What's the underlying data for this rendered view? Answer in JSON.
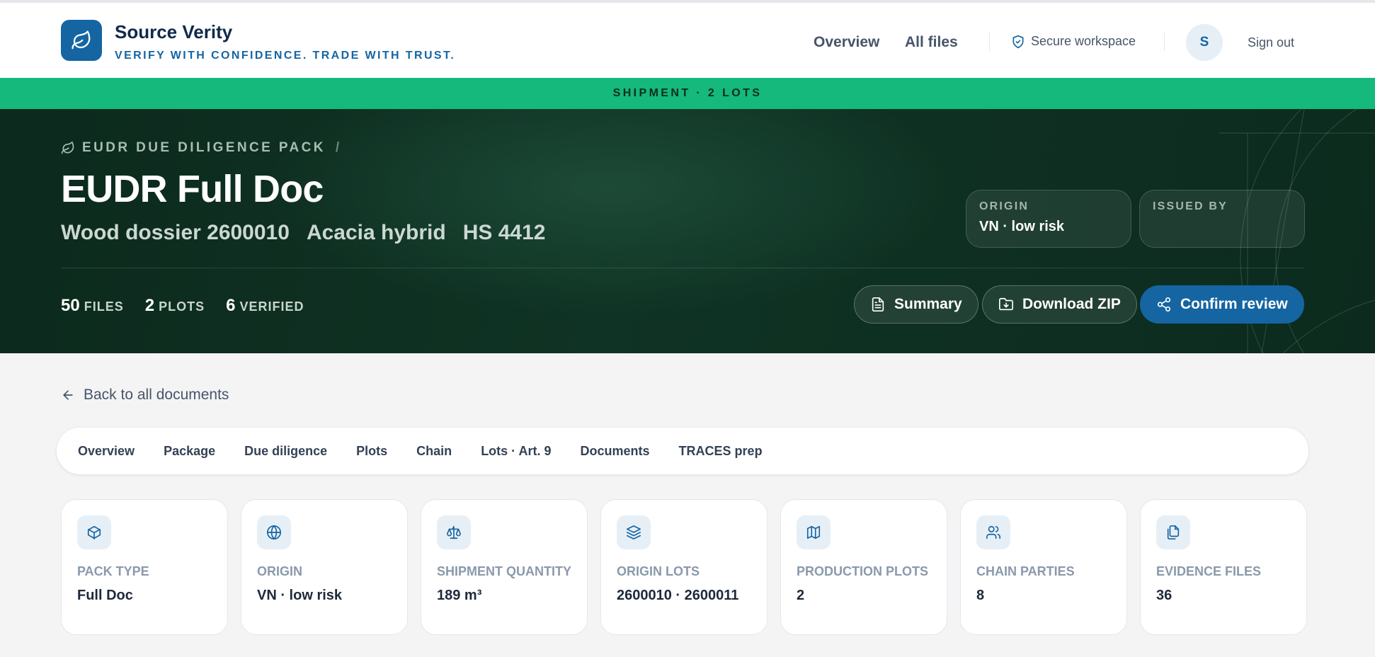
{
  "brand": {
    "name": "Source Verity",
    "tagline": "VERIFY WITH CONFIDENCE. TRADE WITH TRUST.",
    "logo_icon": "leaf-icon",
    "color": "#1565a3"
  },
  "nav": {
    "overview": "Overview",
    "all_files": "All files",
    "secure": "Secure workspace",
    "avatar_initial": "S",
    "sign_out": "Sign out"
  },
  "ribbon": {
    "text": "SHIPMENT · 2 LOTS",
    "color": "#14b97b"
  },
  "hero": {
    "breadcrumb": "EUDR DUE DILIGENCE PACK",
    "breadcrumb_sep": "/",
    "title": "EUDR Full Doc",
    "subtitle": [
      "Wood dossier 2600010",
      "Acacia hybrid",
      "HS 4412"
    ],
    "origin": {
      "label": "ORIGIN",
      "value": "VN · low risk"
    },
    "issued_by": {
      "label": "ISSUED BY",
      "value": ""
    },
    "stats": [
      {
        "value": "50",
        "label": "FILES"
      },
      {
        "value": "2",
        "label": "PLOTS"
      },
      {
        "value": "6",
        "label": "VERIFIED"
      }
    ],
    "buttons": {
      "summary": "Summary",
      "download": "Download ZIP",
      "confirm": "Confirm review"
    }
  },
  "back_link": "Back to all documents",
  "tabs": [
    "Overview",
    "Package",
    "Due diligence",
    "Plots",
    "Chain",
    "Lots · Art. 9",
    "Documents",
    "TRACES prep"
  ],
  "cards": [
    {
      "icon": "box-icon",
      "label": "PACK TYPE",
      "value": "Full Doc"
    },
    {
      "icon": "globe-icon",
      "label": "ORIGIN",
      "value": "VN · low risk"
    },
    {
      "icon": "scale-icon",
      "label": "SHIPMENT QUANTITY",
      "value": "189 m³"
    },
    {
      "icon": "layers-icon",
      "label": "ORIGIN LOTS",
      "value": "2600010 · 2600011"
    },
    {
      "icon": "map-icon",
      "label": "PRODUCTION PLOTS",
      "value": "2"
    },
    {
      "icon": "users-icon",
      "label": "CHAIN PARTIES",
      "value": "8"
    },
    {
      "icon": "files-icon",
      "label": "EVIDENCE FILES",
      "value": "36"
    }
  ]
}
